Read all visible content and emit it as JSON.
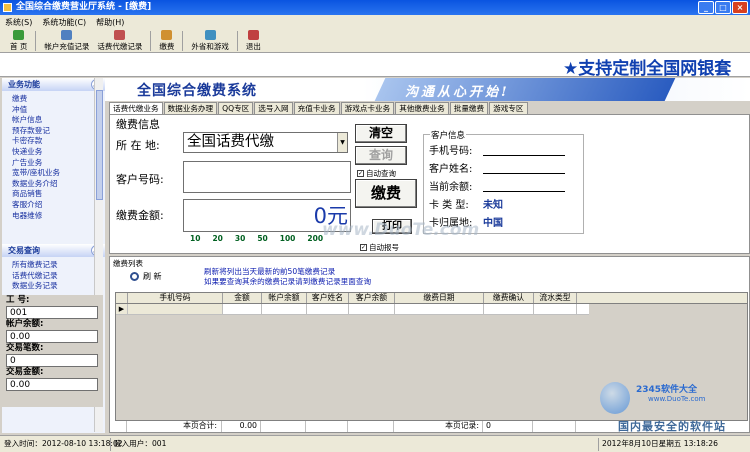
{
  "window": {
    "title": "全国综合缴费营业厅系统 - [缴费]",
    "controls": {
      "minimize": "_",
      "maximize": "□",
      "close": "×"
    }
  },
  "menu": [
    "系统(S)",
    "系统功能(C)",
    "帮助(H)"
  ],
  "toolbar": [
    {
      "label": "首 页",
      "icon": "home-icon",
      "color": "#3a9a3a"
    },
    {
      "label": "帐户充值记录",
      "icon": "search-icon",
      "color": "#5080c0"
    },
    {
      "label": "话费代缴记录",
      "icon": "record-icon",
      "color": "#c05050"
    },
    {
      "label": "缴费",
      "icon": "pay-icon",
      "color": "#d09030"
    },
    {
      "label": "外省和游戏",
      "icon": "game-icon",
      "color": "#4090c0"
    },
    {
      "label": "退出",
      "icon": "exit-icon",
      "color": "#c04040"
    }
  ],
  "banner_text": "★支持定制全国网银套",
  "sidebar": {
    "section1": {
      "title": "业务功能",
      "items": [
        "缴费",
        "冲值",
        "帐户信息",
        "预存款登记",
        "卡密存款",
        "快递业务",
        "广告业务",
        "宽带/座机业务",
        "数据业务介绍",
        "商品销售",
        "客服介绍",
        "电器维修"
      ]
    },
    "section2": {
      "title": "交易查询",
      "items": [
        "所有缴费记录",
        "话费代缴记录",
        "数据业务记录"
      ]
    }
  },
  "stats": {
    "id_label": "工   号:",
    "id_value": "001",
    "balance_label": "帐户余额:",
    "balance_value": "0.00",
    "count_label": "交易笔数:",
    "count_value": "0",
    "amount_label": "交易金额:",
    "amount_value": "0.00"
  },
  "sysbanner": {
    "logo": "全国综合缴费系统",
    "slogan": "沟通从心开始!"
  },
  "tabs": [
    "话费代缴业务",
    "数据业务办理",
    "QQ专区",
    "选号入网",
    "充值卡业务",
    "游戏点卡业务",
    "其他缴费业务",
    "批量缴费",
    "游戏专区"
  ],
  "form": {
    "section_title": "缴费信息",
    "location_label": "所 在 地:",
    "location_value": "全国话费代缴",
    "customer_label": "客户号码:",
    "amount_label": "缴费金额:",
    "amount_value": "0元",
    "quick_amounts": [
      "10",
      "20",
      "30",
      "50",
      "100",
      "200"
    ],
    "clear_button": "清空",
    "query_button": "查询",
    "auto_query": "自动查询",
    "pay_button": "缴费",
    "print_button": "打印",
    "auto_report": "自动报号"
  },
  "customer": {
    "title": "客户信息",
    "phone_label": "手机号码:",
    "name_label": "客户姓名:",
    "balance_label": "当前余额:",
    "card_type_label": "卡 类 型:",
    "card_type_value": "未知",
    "card_location_label": "卡归属地:",
    "card_location_value": "中国"
  },
  "list": {
    "title": "缴费列表",
    "refresh": "刷 新",
    "notes": [
      "刷新将列出当天最新的前50笔缴费记录",
      "如果要查询其余的缴费记录请到缴费记录里面查询"
    ],
    "columns": [
      "手机号码",
      "金额",
      "帐户余额",
      "客户姓名",
      "客户余额",
      "缴费日期",
      "缴费确认",
      "流水类型"
    ],
    "footer": {
      "total_label": "本页合计:",
      "total_value": "0.00",
      "records_label": "本页记录:",
      "records_value": "0"
    }
  },
  "statusbar": {
    "login_time": "登入时间：2012-08-10 13:18:02",
    "login_user": "登入用户：001",
    "datetime": "2012年8月10日星期五 13:18:26"
  },
  "watermark": {
    "brand": "2345软件大全",
    "url": "www.DuoTe.com",
    "slogan": "国内最安全的软件站",
    "overlay": "www.DuoTe.com"
  }
}
